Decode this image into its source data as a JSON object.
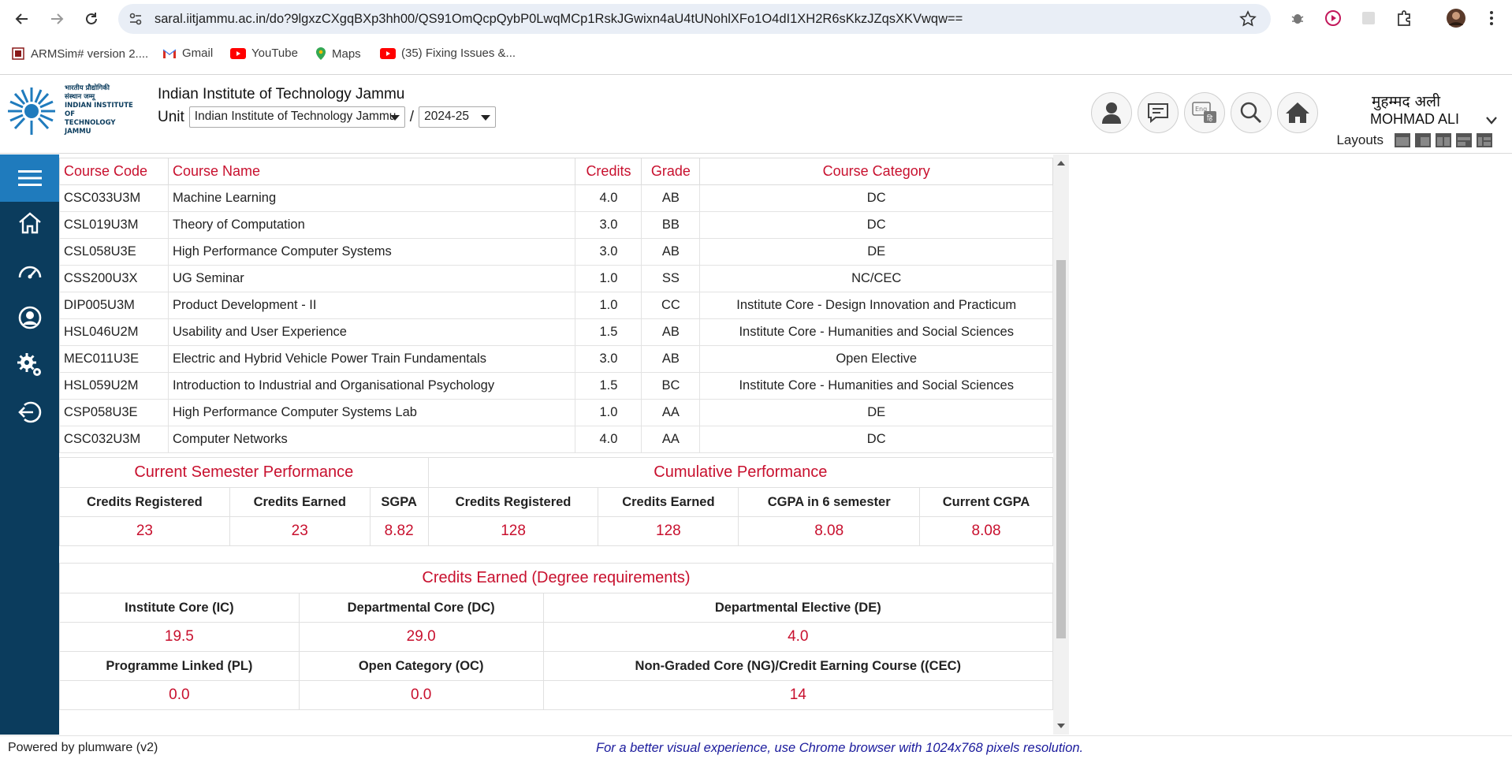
{
  "browser": {
    "url": "saral.iitjammu.ac.in/do?9lgxzCXgqBXp3hh00/QS91OmQcpQybP0LwqMCp1RskJGwixn4aU4tUNohlXFo1O4dI1XH2R6sKkzJZqsXKVwqw==",
    "bookmarks": [
      {
        "label": "ARMSim# version 2...."
      },
      {
        "label": "Gmail"
      },
      {
        "label": "YouTube"
      },
      {
        "label": "Maps"
      },
      {
        "label": "(35) Fixing Issues &..."
      }
    ]
  },
  "header": {
    "logo_text": [
      "भारतीय प्रौद्योगिकी",
      "संस्थान जम्मू",
      "INDIAN INSTITUTE OF",
      "TECHNOLOGY JAMMU"
    ],
    "institute_name": "Indian Institute of Technology Jammu",
    "unit_label": "Unit",
    "unit_value": "Indian Institute of Technology Jammu",
    "separator": "/",
    "year_value": "2024-25",
    "user_hindi": "मुहम्मद अली",
    "user_name": "MOHMAD ALI",
    "layouts_label": "Layouts",
    "lang_icon_text": "Eng"
  },
  "courses": {
    "headers": [
      "Course Code",
      "Course Name",
      "Credits",
      "Grade",
      "Course Category"
    ],
    "rows": [
      [
        "CSC033U3M",
        "Machine Learning",
        "4.0",
        "AB",
        "DC"
      ],
      [
        "CSL019U3M",
        "Theory of Computation",
        "3.0",
        "BB",
        "DC"
      ],
      [
        "CSL058U3E",
        "High Performance Computer Systems",
        "3.0",
        "AB",
        "DE"
      ],
      [
        "CSS200U3X",
        "UG Seminar",
        "1.0",
        "SS",
        "NC/CEC"
      ],
      [
        "DIP005U3M",
        "Product Development - II",
        "1.0",
        "CC",
        "Institute Core - Design Innovation and Practicum"
      ],
      [
        "HSL046U2M",
        "Usability and User Experience",
        "1.5",
        "AB",
        "Institute Core - Humanities and Social Sciences"
      ],
      [
        "MEC011U3E",
        "Electric and Hybrid Vehicle Power Train Fundamentals",
        "3.0",
        "AB",
        "Open Elective"
      ],
      [
        "HSL059U2M",
        "Introduction to Industrial and Organisational Psychology",
        "1.5",
        "BC",
        "Institute Core - Humanities and Social Sciences"
      ],
      [
        "CSP058U3E",
        "High Performance Computer Systems Lab",
        "1.0",
        "AA",
        "DE"
      ],
      [
        "CSC032U3M",
        "Computer Networks",
        "4.0",
        "AA",
        "DC"
      ]
    ]
  },
  "performance": {
    "current_title": "Current Semester Performance",
    "cumulative_title": "Cumulative Performance",
    "labels": [
      "Credits Registered",
      "Credits Earned",
      "SGPA",
      "Credits Registered",
      "Credits Earned",
      "CGPA in 6 semester",
      "Current CGPA"
    ],
    "values": [
      "23",
      "23",
      "8.82",
      "128",
      "128",
      "8.08",
      "8.08"
    ]
  },
  "degree": {
    "title": "Credits Earned (Degree requirements)",
    "row1_labels": [
      "Institute Core (IC)",
      "Departmental Core (DC)",
      "Departmental Elective (DE)"
    ],
    "row1_values": [
      "19.5",
      "29.0",
      "4.0"
    ],
    "row2_labels": [
      "Programme Linked (PL)",
      "Open Category (OC)",
      "Non-Graded Core (NG)/Credit Earning Course ((CEC)"
    ],
    "row2_values": [
      "0.0",
      "0.0",
      "14"
    ]
  },
  "footer": {
    "powered": "Powered by plumware (v2)",
    "note": "For a better visual experience, use Chrome browser with 1024x768 pixels resolution."
  },
  "colors": {
    "accent_red": "#c8102e",
    "sidebar_bg": "#0b3c5d",
    "sidebar_active": "#1f7bbd",
    "footer_note": "#1a1a9c"
  },
  "icons": {
    "sidebar": [
      "menu-icon",
      "home-icon",
      "dashboard-icon",
      "profile-icon",
      "settings-icon",
      "logout-icon"
    ],
    "header": [
      "user-icon",
      "chat-icon",
      "language-icon",
      "search-icon",
      "home-icon"
    ]
  }
}
